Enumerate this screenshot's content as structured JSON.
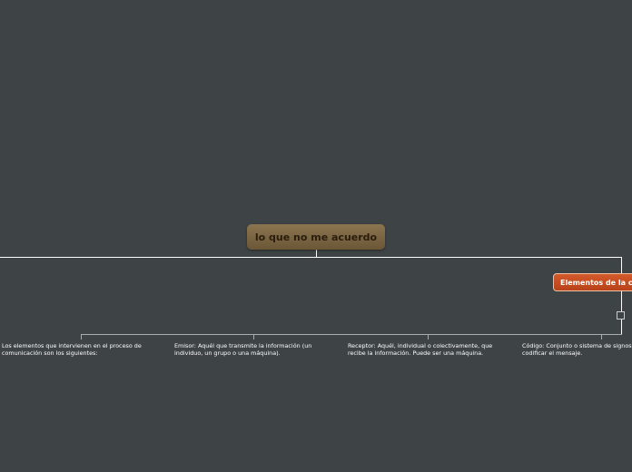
{
  "map": {
    "root": {
      "label": "lo que no me acuerdo"
    },
    "branch": {
      "label": "Elementos de la c"
    },
    "leaves": [
      {
        "text": "Los elementos que intervienen en el proceso de comunicación son los siguientes:"
      },
      {
        "text": "Emisor: Aquél que transmite la información (un individuo, un grupo o una máquina)."
      },
      {
        "text": "Receptor: Aquél, individual o colectivamente, que recibe la información. Puede ser una máquina."
      },
      {
        "text": "Código: Conjunto o sistema de signos utiliza para codificar el mensaje."
      }
    ]
  },
  "colors": {
    "background": "#3e4345",
    "root_fill": "#7a6443",
    "branch_fill": "#c94e22",
    "connector_main": "#ffffff",
    "connector_leaf": "#a9adaf"
  },
  "icons": {
    "collapse_toggle": "collapse-square-icon"
  }
}
